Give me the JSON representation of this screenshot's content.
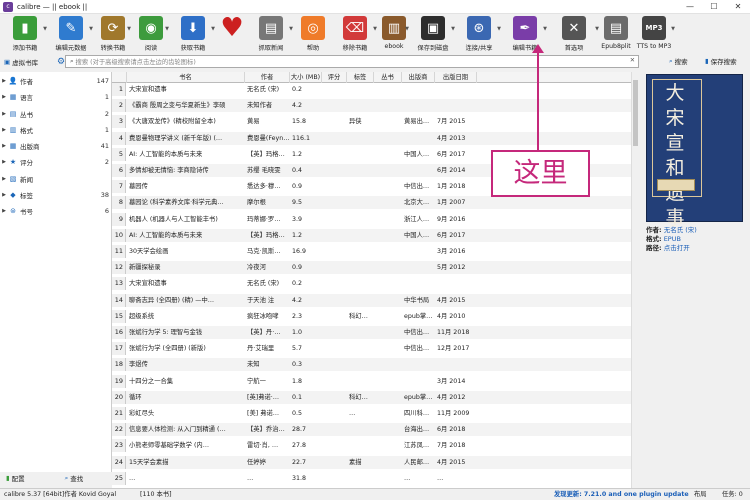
{
  "window": {
    "title": "calibre — || ebook ||",
    "min": "—",
    "max": "☐",
    "close": "✕"
  },
  "toolbar": [
    {
      "label": "添加书籍",
      "color": "#3a9d3a",
      "icon": "add-book-icon",
      "glyph": "▮",
      "arrow": true
    },
    {
      "label": "编辑元数据",
      "color": "#2f7bcf",
      "icon": "edit-metadata-icon",
      "glyph": "✎",
      "arrow": true
    },
    {
      "label": "转换书籍",
      "color": "#a0782c",
      "icon": "convert-book-icon",
      "glyph": "⟳",
      "arrow": true
    },
    {
      "label": "阅读",
      "color": "#3d9b3d",
      "icon": "view-book-icon",
      "glyph": "◉",
      "arrow": true
    },
    {
      "label": "获取书籍",
      "color": "#2e6fc7",
      "icon": "get-books-icon",
      "glyph": "⬇",
      "arrow": true
    },
    {
      "label": "",
      "color": "#cc2020",
      "icon": "heart-icon",
      "glyph": "♥",
      "arrow": false
    },
    {
      "label": "抓取新闻",
      "color": "#777777",
      "icon": "fetch-news-icon",
      "glyph": "▤",
      "arrow": true
    },
    {
      "label": "帮助",
      "color": "#ef7b2a",
      "icon": "help-icon",
      "glyph": "◎",
      "arrow": false
    },
    {
      "label": "移除书籍",
      "color": "#d23a3a",
      "icon": "remove-book-icon",
      "glyph": "⌫",
      "arrow": true
    },
    {
      "label": "ebook",
      "color": "#8a5a2c",
      "icon": "library-icon",
      "glyph": "▥",
      "arrow": true
    },
    {
      "label": "保存到磁盘",
      "color": "#2d2d2d",
      "icon": "save-to-disk-icon",
      "glyph": "▣",
      "arrow": true
    },
    {
      "label": "连接/共享",
      "color": "#3b68b2",
      "icon": "connect-share-icon",
      "glyph": "⊛",
      "arrow": true
    },
    {
      "label": "编辑书籍",
      "color": "#7a3da8",
      "icon": "edit-book-icon",
      "glyph": "✒",
      "arrow": true
    },
    {
      "label": "首选项",
      "color": "#555555",
      "icon": "preferences-icon",
      "glyph": "✕",
      "arrow": true
    },
    {
      "label": "Epub8plit",
      "color": "#6b6b6b",
      "icon": "epub-split-icon",
      "glyph": "▤",
      "arrow": false
    },
    {
      "label": "TTS to MP3",
      "color": "#444444",
      "icon": "tts-mp3-icon",
      "glyph": "MP3",
      "arrow": true
    }
  ],
  "search": {
    "vlib_label": "虚拟书库",
    "placeholder": "搜索 (对于高级搜索请点击左边的齿轮图标)",
    "search_button": "搜索",
    "saved_button": "保存搜索"
  },
  "sidebar": {
    "items": [
      {
        "name": "作者",
        "count": "147",
        "icon": "author-icon",
        "glyph": "👤"
      },
      {
        "name": "语言",
        "count": "1",
        "icon": "language-icon",
        "glyph": "▦"
      },
      {
        "name": "丛书",
        "count": "2",
        "icon": "series-icon",
        "glyph": "▤"
      },
      {
        "name": "格式",
        "count": "1",
        "icon": "format-icon",
        "glyph": "▥"
      },
      {
        "name": "出版商",
        "count": "41",
        "icon": "publisher-icon",
        "glyph": "▦"
      },
      {
        "name": "评分",
        "count": "2",
        "icon": "rating-icon",
        "glyph": "★"
      },
      {
        "name": "新闻",
        "count": "",
        "icon": "news-icon",
        "glyph": "▧"
      },
      {
        "name": "标签",
        "count": "38",
        "icon": "tags-icon",
        "glyph": "◆"
      },
      {
        "name": "书号",
        "count": "6",
        "icon": "identifiers-icon",
        "glyph": "⊜"
      }
    ],
    "configure": "配置",
    "find": "查找"
  },
  "table": {
    "headers": [
      "书名",
      "作者",
      "大小 (MB)",
      "评分",
      "标签",
      "丛书",
      "出版商",
      "出版日期"
    ],
    "rows": [
      [
        "大宋宣和遗事",
        "无名氏 (宋)",
        "0.2",
        "",
        "",
        "",
        "",
        ""
      ],
      [
        "《霸商 殷周之变与华夏新生》李硕",
        "未知作者",
        "4.2",
        "",
        "",
        "",
        "",
        ""
      ],
      [
        "《大唐双龙传》(精校附留全本)",
        "黄易",
        "15.8",
        "",
        "异侠",
        "",
        "黄易出…",
        "7月 2015"
      ],
      [
        "费恩曼物理学讲义 (新千年版) (…",
        "费恩曼(Feyn…",
        "116.1",
        "",
        "",
        "",
        "",
        "4月 2013"
      ],
      [
        "AI: 人工智能的本质与未来",
        "【英】玛格…",
        "1.2",
        "",
        "",
        "",
        "中国人…",
        "6月 2017"
      ],
      [
        "多情却被无情恼: 李商隐诗传",
        "苏缨 毛晓雯",
        "0.4",
        "",
        "",
        "",
        "",
        "6月 2014"
      ],
      [
        "墓园传",
        "悉达多·穆…",
        "0.9",
        "",
        "",
        "",
        "中信出…",
        "1月 2018"
      ],
      [
        "墓园论 (科学素养文库·科学元典…",
        "摩尔根",
        "9.5",
        "",
        "",
        "",
        "北京大…",
        "1月 2007"
      ],
      [
        "机器人 (机器人与人工智能丰书)",
        "玛蒂娜·罗…",
        "3.9",
        "",
        "",
        "",
        "浙江人…",
        "9月 2016"
      ],
      [
        "AI: 人工智能的本质与未来",
        "【英】玛格…",
        "1.2",
        "",
        "",
        "",
        "中国人…",
        "6月 2017"
      ],
      [
        "30天学会绘画",
        "马克·凯斯…",
        "16.9",
        "",
        "",
        "",
        "",
        "3月 2016"
      ],
      [
        "新疆探秘录",
        "冷夜河",
        "0.9",
        "",
        "",
        "",
        "",
        "5月 2012"
      ],
      [
        "大宋宣和遗事",
        "无名氏 (宋)",
        "0.2",
        "",
        "",
        "",
        "",
        ""
      ],
      [
        "聊斋志异 (全四册) (精) —中…",
        "于天池 注",
        "4.2",
        "",
        "",
        "",
        "中华书局",
        "4月 2015"
      ],
      [
        "超级系统",
        "疯狂冰咆哮",
        "2.3",
        "",
        "科幻…",
        "",
        "epub掌…",
        "4月 2010"
      ],
      [
        "张斌行为学 5: 理智与金钱",
        "【英】丹·…",
        "1.0",
        "",
        "",
        "",
        "中信出…",
        "11月 2018"
      ],
      [
        "张斌行为学 (全四册) (新版)",
        "丹·艾瑞里",
        "5.7",
        "",
        "",
        "",
        "中信出…",
        "12月 2017"
      ],
      [
        "李煜传",
        "未知",
        "0.3",
        "",
        "",
        "",
        "",
        ""
      ],
      [
        "十四分之一合集",
        "宁航一",
        "1.8",
        "",
        "",
        "",
        "",
        "3月 2014"
      ],
      [
        "循环",
        "[英]弗诺·…",
        "0.1",
        "",
        "科幻…",
        "",
        "epub掌…",
        "4月 2012"
      ],
      [
        "彩虹尽头",
        "[美] 弗诺…",
        "0.5",
        "",
        "…",
        "",
        "四川科…",
        "11月 2009"
      ],
      [
        "信息要人体检测: 从入门到精通 (…",
        "【英】乔治…",
        "28.7",
        "",
        "",
        "",
        "台海出…",
        "6月 2018"
      ],
      [
        "小熊老师零基础学数学 (内…",
        "雷切·肖, …",
        "27.8",
        "",
        "",
        "",
        "江苏凤…",
        "7月 2018"
      ],
      [
        "15天学会素描",
        "任婷婷",
        "22.7",
        "",
        "素描",
        "",
        "人民邮…",
        "4月 2015"
      ],
      [
        "…",
        "…",
        "31.8",
        "",
        "",
        "",
        "…",
        "…"
      ]
    ]
  },
  "details": {
    "cover_title": "大宋宣和遗事",
    "author_key": "作者:",
    "author_val": "无名氏 (宋)",
    "format_key": "格式:",
    "format_val": "EPUB",
    "path_key": "路径:",
    "path_val": "点击打开"
  },
  "statusbar": {
    "left": "calibre 5.37 [64bit]作者 Kovid Goyal",
    "count": "[110 本书]",
    "update": "发现更新: 7.21.0 and one plugin update",
    "layout": "布局",
    "jobs": "任务: 0"
  },
  "annotation": {
    "text": "这里",
    "color": "#c5287b"
  }
}
